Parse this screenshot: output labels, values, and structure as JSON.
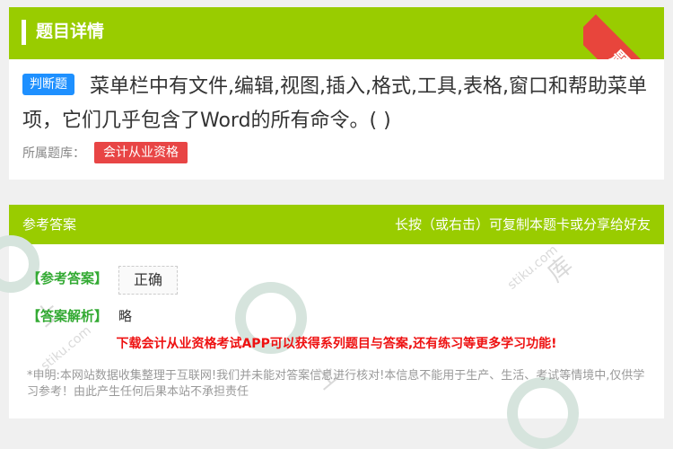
{
  "header": {
    "title": "题目详情",
    "ribbon_label": "题卡"
  },
  "question": {
    "type_badge": "判断题",
    "text": "菜单栏中有文件,编辑,视图,插入,格式,工具,表格,窗口和帮助菜单项，它们几乎包含了Word的所有命令。( )",
    "bank_label": "所属题库：",
    "bank_name": "会计从业资格"
  },
  "answer": {
    "header_left": "参考答案",
    "header_right": "长按（或右击）可复制本题卡或分享给好友",
    "ref_label": "【参考答案】",
    "ref_value": "正确",
    "analysis_label": "【答案解析】",
    "analysis_value": "略",
    "download_promo": "下载会计从业资格考试APP可以获得系列题目与答案,还有练习等更多学习功能!",
    "disclaimer": "*申明:本网站数据收集整理于互联网!我们并未能对答案信息进行核对!本信息不能用于生产、生活、考试等情境中,仅供学习参考！由此产生任何后果本站不承担责任"
  },
  "colors": {
    "accent_green": "#99cc00",
    "badge_blue": "#1e90ff",
    "tag_red": "#e84545",
    "promo_red": "#ee1111"
  }
}
